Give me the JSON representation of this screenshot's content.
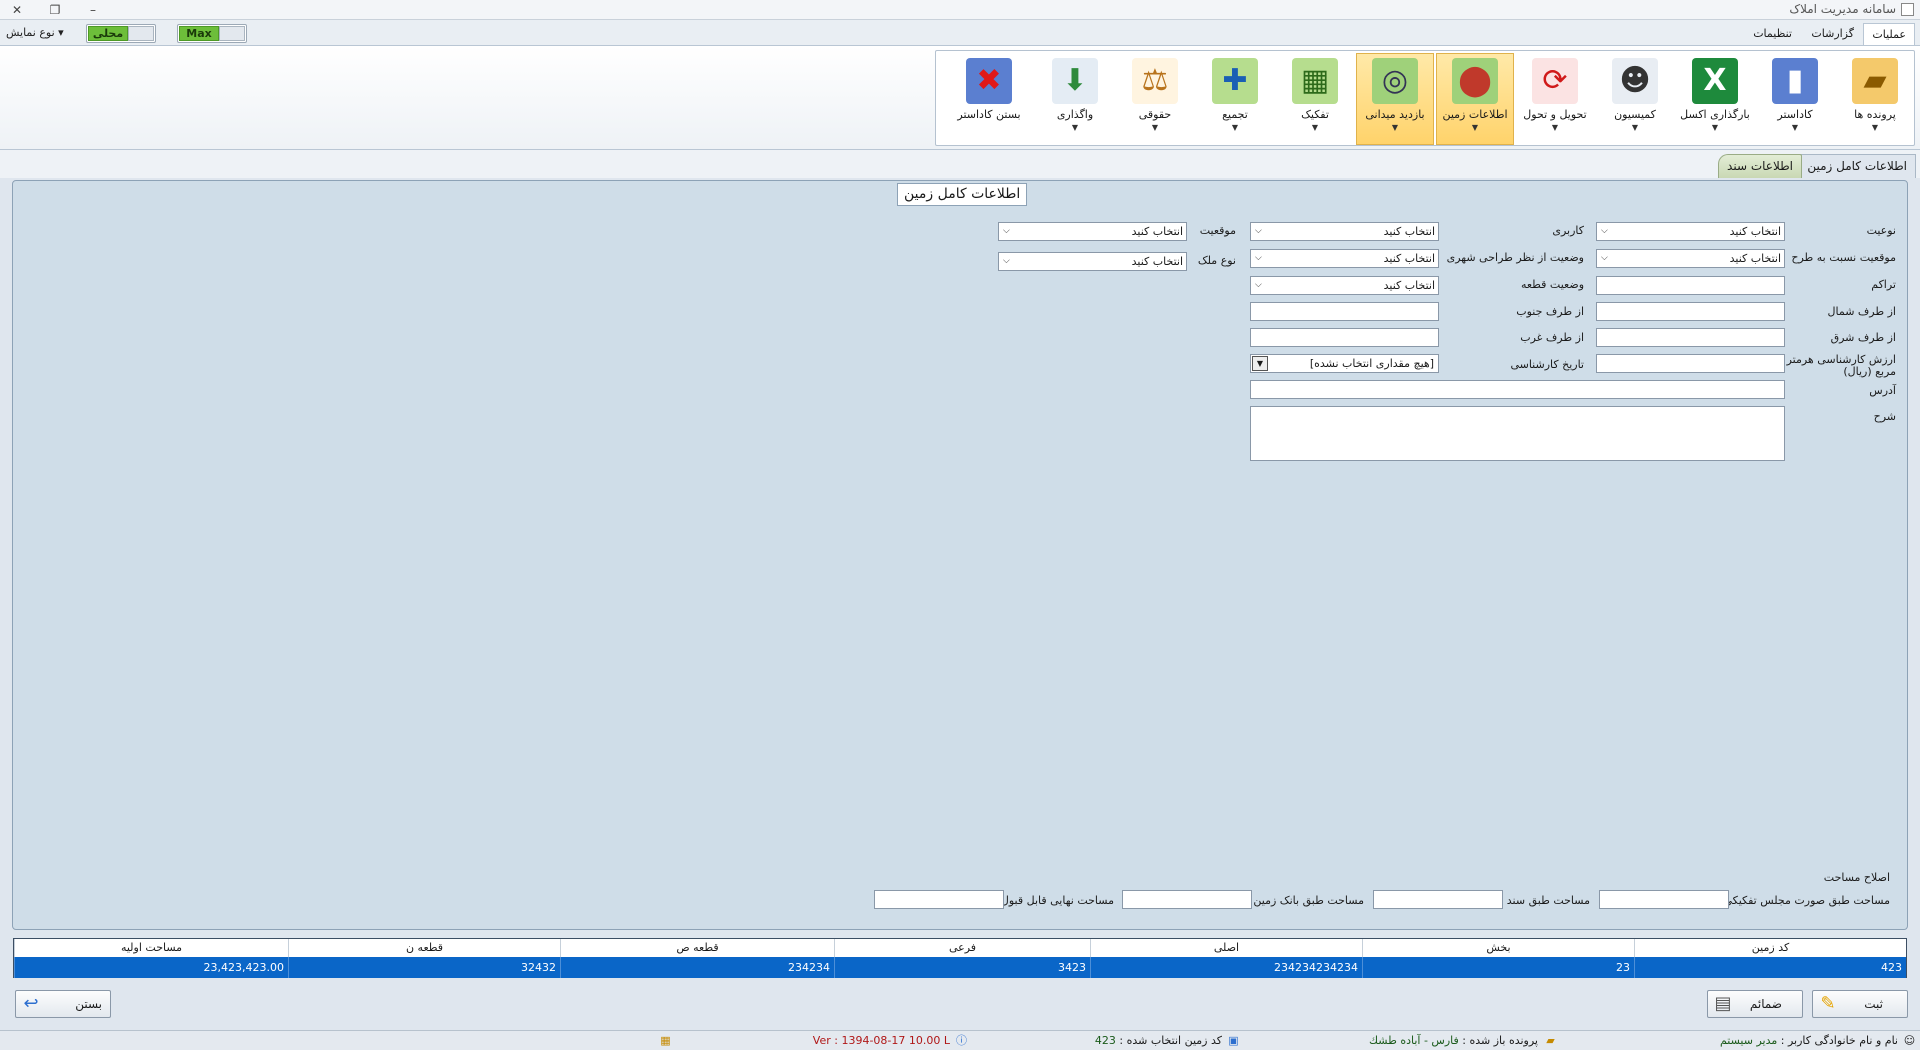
{
  "window": {
    "title": "سامانه مدیریت املاک"
  },
  "menu_tabs": [
    {
      "label": "عملیات"
    },
    {
      "label": "گزارشات"
    },
    {
      "label": "تنظیمات"
    }
  ],
  "view": {
    "toggle1_label": "Max",
    "toggle2_label": "محلی",
    "type_label": "نوع نمایش"
  },
  "ribbon": {
    "buttons": [
      {
        "label": "پرونده ها",
        "icon": "folder-icon"
      },
      {
        "label": "کاداستر",
        "icon": "book-icon"
      },
      {
        "label": "بارگذاری اکسل",
        "icon": "excel-icon"
      },
      {
        "label": "کمیسیون",
        "icon": "people-icon"
      },
      {
        "label": "تحویل و تحول",
        "icon": "refresh-icon"
      },
      {
        "label": "اطلاعات زمین",
        "icon": "map-pin-icon"
      },
      {
        "label": "بازدید میدانی",
        "icon": "map-search-icon"
      },
      {
        "label": "تفکیک",
        "icon": "split-icon"
      },
      {
        "label": "تجمیع",
        "icon": "merge-icon"
      },
      {
        "label": "حقوقی",
        "icon": "scales-icon"
      },
      {
        "label": "واگذاری",
        "icon": "transfer-icon"
      },
      {
        "label": "بستن کاداستر",
        "icon": "close-book-icon"
      }
    ]
  },
  "doc_tabs": [
    {
      "label": "اطلاعات کامل زمین"
    },
    {
      "label": "اطلاعات سند"
    }
  ],
  "form": {
    "title": "اطلاعات کامل زمین",
    "select_placeholder": "انتخاب کنید",
    "labels": {
      "type": "نوعیت",
      "usage": "کاربری",
      "location": "موقعیت",
      "plan_position": "موقعیت نسبت به طرح",
      "urban_status": "وضعیت از نظر طراحی شهری",
      "property_type": "نوع ملک",
      "density": "تراکم",
      "parcel_status": "وضعیت قطعه",
      "north": "از طرف شمال",
      "south": "از طرف جنوب",
      "east": "از طرف شرق",
      "west": "از طرف غرب",
      "expert_value": "ارزش کارشناسی هرمتر مربع (ریال)",
      "expert_date": "تاریخ کارشناسی",
      "address": "آدرس",
      "description": "شرح",
      "area_correction": "اصلاح مساحت",
      "area_by_session": "مساحت طبق صورت مجلس تفکیکی",
      "area_by_deed": "مساحت طبق سند",
      "area_by_landbank": "مساحت طبق بانک زمین",
      "final_area": "مساحت نهایی قابل قبول"
    },
    "date_value": "[هیچ مقداری انتخاب نشده]"
  },
  "grid": {
    "columns": [
      "کد زمین",
      "بخش",
      "اصلی",
      "فرعی",
      "قطعه ص",
      "قطعه ن",
      "مساحت اولیه"
    ],
    "rows": [
      [
        "423",
        "23",
        "234234234234",
        "3423",
        "234234",
        "32432",
        "23,423,423.00"
      ]
    ]
  },
  "buttons": {
    "save": "ثبت",
    "attachments": "ضمائم",
    "close": "بستن"
  },
  "status": {
    "user_label": "نام و نام خانوادگی کاربر :",
    "user_value": "مدیر سیستم",
    "file_label": "پرونده باز شده :",
    "file_value": "فارس - آباده طشك",
    "land_code_label": "کد زمین انتخاب شده :",
    "land_code_value": "423",
    "version": "Ver : 1394-08-17 10.00 L"
  },
  "colors": {
    "accent": "#0a66c8",
    "panel": "#cfdde8",
    "ribbon_selected": "#ffd36b",
    "toggle_on": "#6dbe3a"
  }
}
